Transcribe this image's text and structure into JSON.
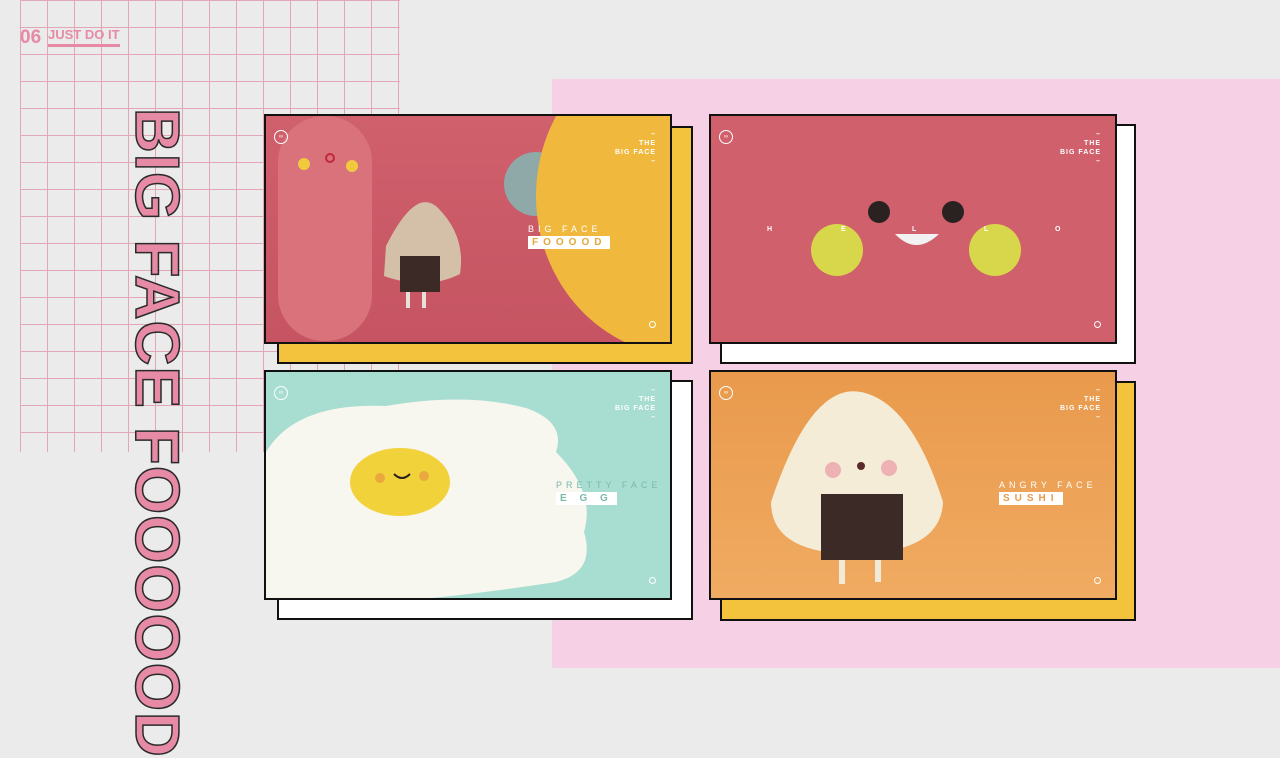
{
  "header": {
    "page_number": "06",
    "tagline": "JUST DO IT"
  },
  "vertical_title": "BIG FACE FOOOOOD",
  "cards": [
    {
      "the": "THE",
      "big_face": "BIG FACE",
      "title": "BIG FACE",
      "subtitle": "FOOOOD",
      "bg": "#cf606c",
      "shadow": "#f4c33e"
    },
    {
      "the": "THE",
      "big_face": "BIG FACE",
      "letters": [
        "H",
        "E",
        "L",
        "L",
        "O"
      ],
      "bg": "#cf606c",
      "shadow": "#ffffff"
    },
    {
      "the": "THE",
      "big_face": "BIG FACE",
      "title": "PRETTY FACE",
      "subtitle": "E G G",
      "bg": "#a8ddd1",
      "shadow": "#ffffff"
    },
    {
      "the": "THE",
      "big_face": "BIG FACE",
      "title": "ANGRY FACE",
      "subtitle": "SUSHI",
      "bg": "#eea356",
      "shadow": "#f4c33e"
    }
  ],
  "colors": {
    "accent": "#e68aa6",
    "pink_panel": "#f6d0e4"
  }
}
